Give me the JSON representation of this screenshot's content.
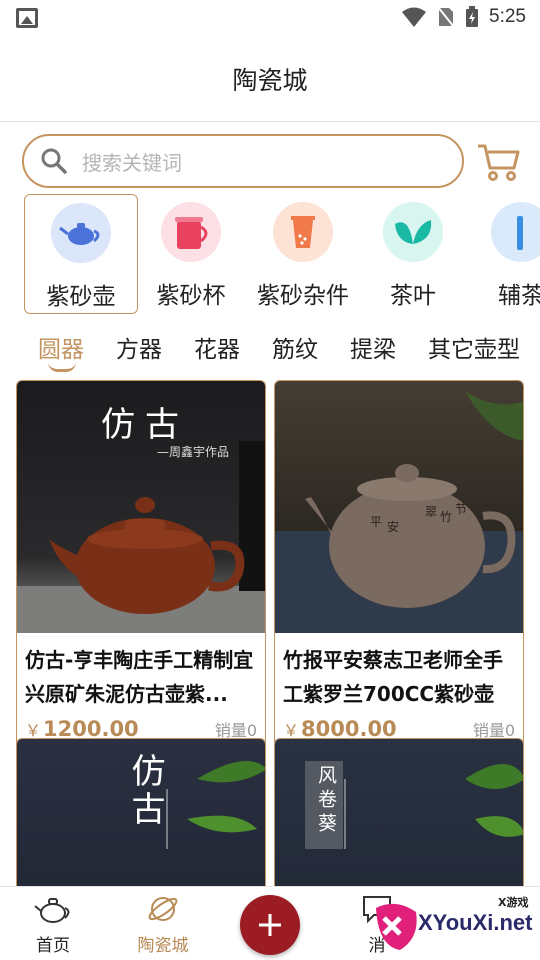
{
  "status_bar": {
    "time": "5:25"
  },
  "header": {
    "title": "陶瓷城"
  },
  "search": {
    "placeholder": "搜索关键词"
  },
  "categories": [
    {
      "label": "紫砂壶",
      "icon": "teapot-icon",
      "active": true
    },
    {
      "label": "紫砂杯",
      "icon": "cup-icon"
    },
    {
      "label": "紫砂杂件",
      "icon": "accessory-icon"
    },
    {
      "label": "茶叶",
      "icon": "tea-leaf-icon"
    },
    {
      "label": "辅茶",
      "icon": "tool-icon"
    }
  ],
  "tabs": [
    "圆器",
    "方器",
    "花器",
    "筋纹",
    "提梁",
    "其它壶型"
  ],
  "products": [
    {
      "name": "仿古-亨丰陶庄手工精制宜兴原矿朱泥仿古壶紫...",
      "currency": "￥",
      "price": "1200.00",
      "sales": "销量0",
      "image_title": "仿古",
      "image_subtitle": "—周鑫宇作品"
    },
    {
      "name": "竹报平安蔡志卫老师全手工紫罗兰700CC紫砂壶",
      "currency": "￥",
      "price": "8000.00",
      "sales": "销量0"
    },
    {
      "image_title": "仿古"
    },
    {
      "image_title": "风卷葵"
    }
  ],
  "bottom_nav": [
    {
      "label": "首页",
      "icon": "home-teapot-icon"
    },
    {
      "label": "陶瓷城",
      "icon": "planet-icon",
      "active": true
    },
    {
      "label": "消",
      "icon": "message-icon"
    }
  ],
  "watermark": {
    "main": "XYouXi.net",
    "small": "X游戏"
  },
  "colors": {
    "accent": "#c49560",
    "price": "#b88a55",
    "plus_button": "#9b1c22"
  }
}
